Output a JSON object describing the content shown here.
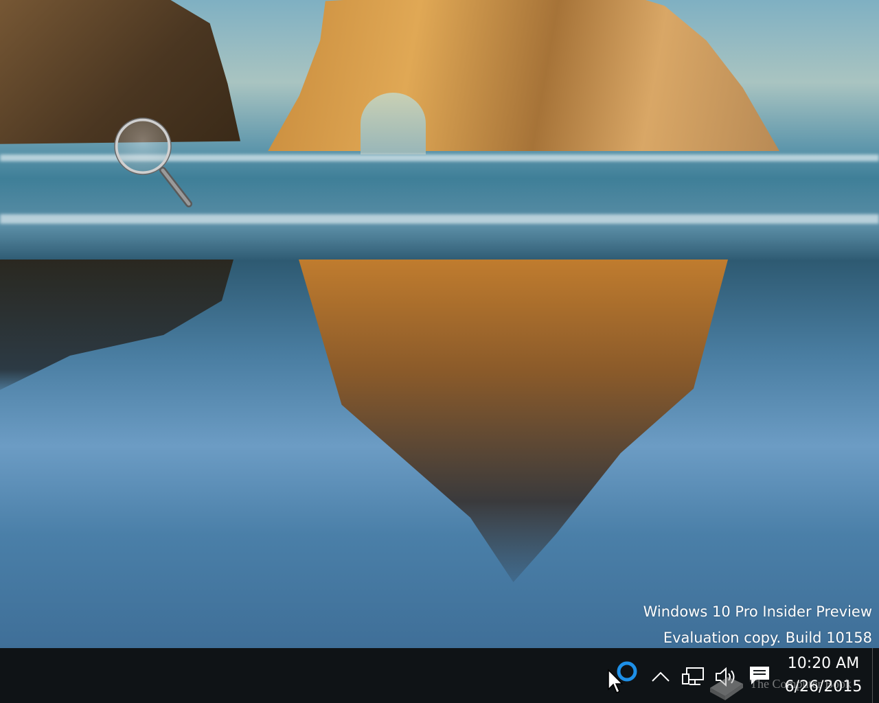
{
  "desktop": {
    "wallpaper": "beach-rock-arch-wallpaper",
    "watermark_line1": "Windows 10 Pro Insider Preview",
    "watermark_line2": "Evaluation copy. Build 10158"
  },
  "magnifier": {
    "icon": "magnifier-icon"
  },
  "taskbar": {
    "background": "#0f1316",
    "cortana_color": "#1e90e8",
    "tray": {
      "chevron_icon": "chevron-up-icon",
      "network_icon": "network-icon",
      "volume_icon": "volume-icon",
      "action_center_icon": "action-center-icon"
    },
    "clock": {
      "time": "10:20 AM",
      "date": "6/26/2015"
    }
  },
  "overlay": {
    "site_text": "The Computer Book"
  }
}
